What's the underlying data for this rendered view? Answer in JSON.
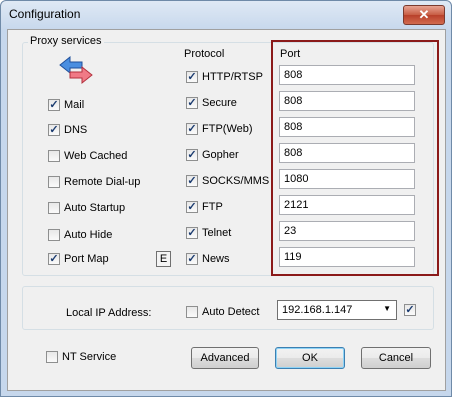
{
  "window": {
    "title": "Configuration",
    "close_glyph": "✕"
  },
  "proxy": {
    "group_label": "Proxy services",
    "icon": "exchange-arrows-icon",
    "services": [
      {
        "label": "Mail",
        "checked": true
      },
      {
        "label": "DNS",
        "checked": true
      },
      {
        "label": "Web Cached",
        "checked": false
      },
      {
        "label": "Remote Dial-up",
        "checked": false
      },
      {
        "label": "Auto Startup",
        "checked": false
      },
      {
        "label": "Auto Hide",
        "checked": false
      },
      {
        "label": "Port Map",
        "checked": true
      }
    ],
    "e_button": "E"
  },
  "protocol": {
    "header": "Protocol",
    "items": [
      {
        "label": "HTTP/RTSP",
        "checked": true
      },
      {
        "label": "Secure",
        "checked": true
      },
      {
        "label": "FTP(Web)",
        "checked": true
      },
      {
        "label": "Gopher",
        "checked": true
      },
      {
        "label": "SOCKS/MMS",
        "checked": true
      },
      {
        "label": "FTP",
        "checked": true
      },
      {
        "label": "Telnet",
        "checked": true
      },
      {
        "label": "News",
        "checked": true
      }
    ]
  },
  "port": {
    "header": "Port",
    "values": [
      "808",
      "808",
      "808",
      "808",
      "1080",
      "2121",
      "23",
      "119"
    ]
  },
  "local_ip": {
    "label": "Local IP Address:",
    "auto_detect_label": "Auto Detect",
    "auto_detect_checked": false,
    "selected": "192.168.1.147",
    "extra_checked": true
  },
  "footer": {
    "nt_service_label": "NT Service",
    "nt_service_checked": false,
    "advanced": "Advanced",
    "ok": "OK",
    "cancel": "Cancel"
  },
  "colors": {
    "port_highlight": "#8b1a1a",
    "title_gradient": "#c6d7ec"
  }
}
